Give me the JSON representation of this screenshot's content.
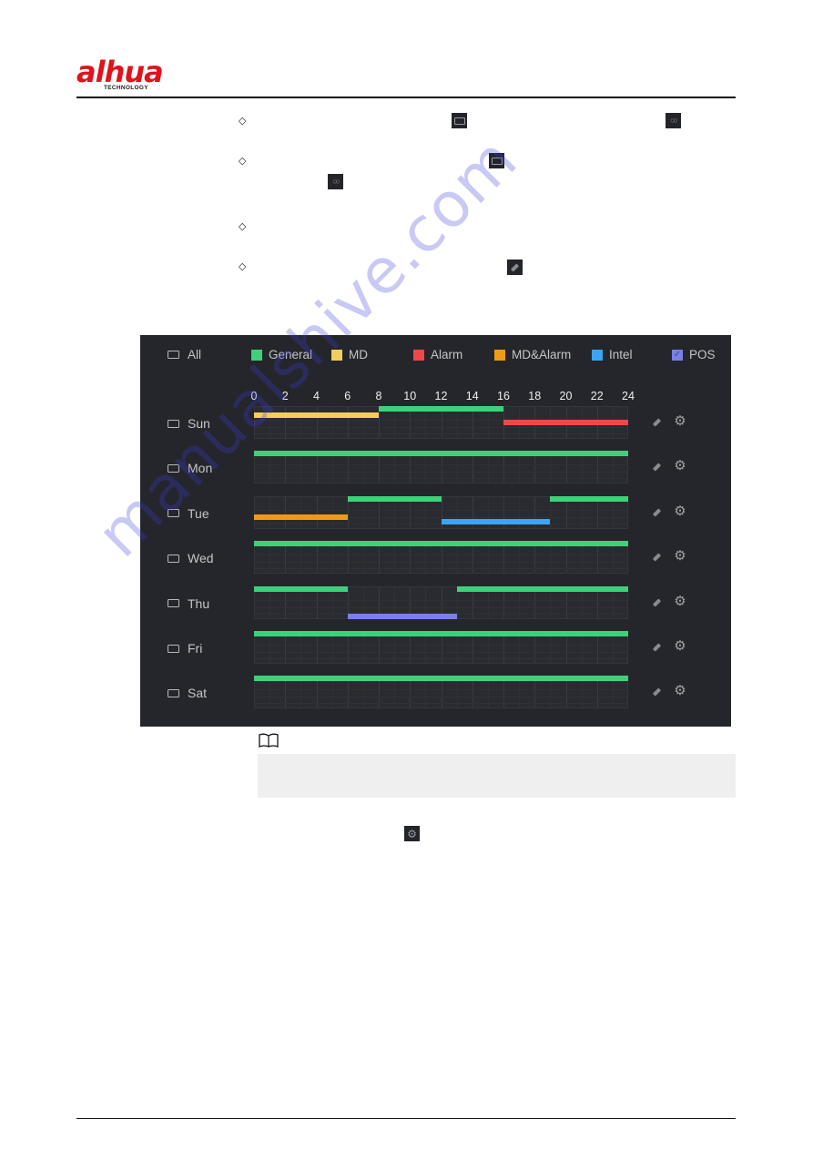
{
  "header": {
    "brand": "alhua",
    "brand_sub": "TECHNOLOGY"
  },
  "bullets": [
    {
      "marker": "◇",
      "icons": [
        "checkbox-rect-icon",
        "link-icon"
      ]
    },
    {
      "marker": "◇",
      "icons": [
        "checkbox-rect-icon",
        "link-icon"
      ]
    },
    {
      "marker": "◇",
      "icons": []
    },
    {
      "marker": "◇",
      "icons": [
        "pencil-icon"
      ]
    }
  ],
  "schedule": {
    "all_label": "All",
    "legend": [
      {
        "key": "general",
        "label": "General",
        "color": "#3dd27a"
      },
      {
        "key": "md",
        "label": "MD",
        "color": "#f2cf5b"
      },
      {
        "key": "alarm",
        "label": "Alarm",
        "color": "#f04848"
      },
      {
        "key": "md_alarm",
        "label": "MD&Alarm",
        "color": "#f09a14"
      },
      {
        "key": "intel",
        "label": "Intel",
        "color": "#3aa5f5"
      },
      {
        "key": "pos",
        "label": "POS",
        "color": "#7a80e6",
        "checked": true
      }
    ],
    "hour_ticks": [
      "0",
      "2",
      "4",
      "6",
      "8",
      "10",
      "12",
      "14",
      "16",
      "18",
      "20",
      "22",
      "24"
    ],
    "days": [
      {
        "label": "Sun",
        "segments": [
          {
            "type": "md",
            "start": 0,
            "end": 8
          },
          {
            "type": "general",
            "start": 8,
            "end": 16
          },
          {
            "type": "alarm",
            "start": 16,
            "end": 24
          }
        ]
      },
      {
        "label": "Mon",
        "segments": [
          {
            "type": "general",
            "start": 0,
            "end": 24
          }
        ]
      },
      {
        "label": "Tue",
        "segments": [
          {
            "type": "general",
            "start": 6,
            "end": 12
          },
          {
            "type": "general",
            "start": 19,
            "end": 24
          },
          {
            "type": "md_alarm",
            "start": 0,
            "end": 6
          },
          {
            "type": "intel",
            "start": 12,
            "end": 19
          }
        ]
      },
      {
        "label": "Wed",
        "segments": [
          {
            "type": "general",
            "start": 0,
            "end": 24
          }
        ]
      },
      {
        "label": "Thu",
        "segments": [
          {
            "type": "general",
            "start": 0,
            "end": 6
          },
          {
            "type": "general",
            "start": 13,
            "end": 24
          },
          {
            "type": "pos",
            "start": 6,
            "end": 13
          }
        ]
      },
      {
        "label": "Fri",
        "segments": [
          {
            "type": "general",
            "start": 0,
            "end": 24
          }
        ]
      },
      {
        "label": "Sat",
        "segments": [
          {
            "type": "general",
            "start": 0,
            "end": 24
          }
        ]
      }
    ]
  },
  "note": {
    "icon": "book-icon",
    "text": ""
  },
  "watermark": "manualshive.com"
}
